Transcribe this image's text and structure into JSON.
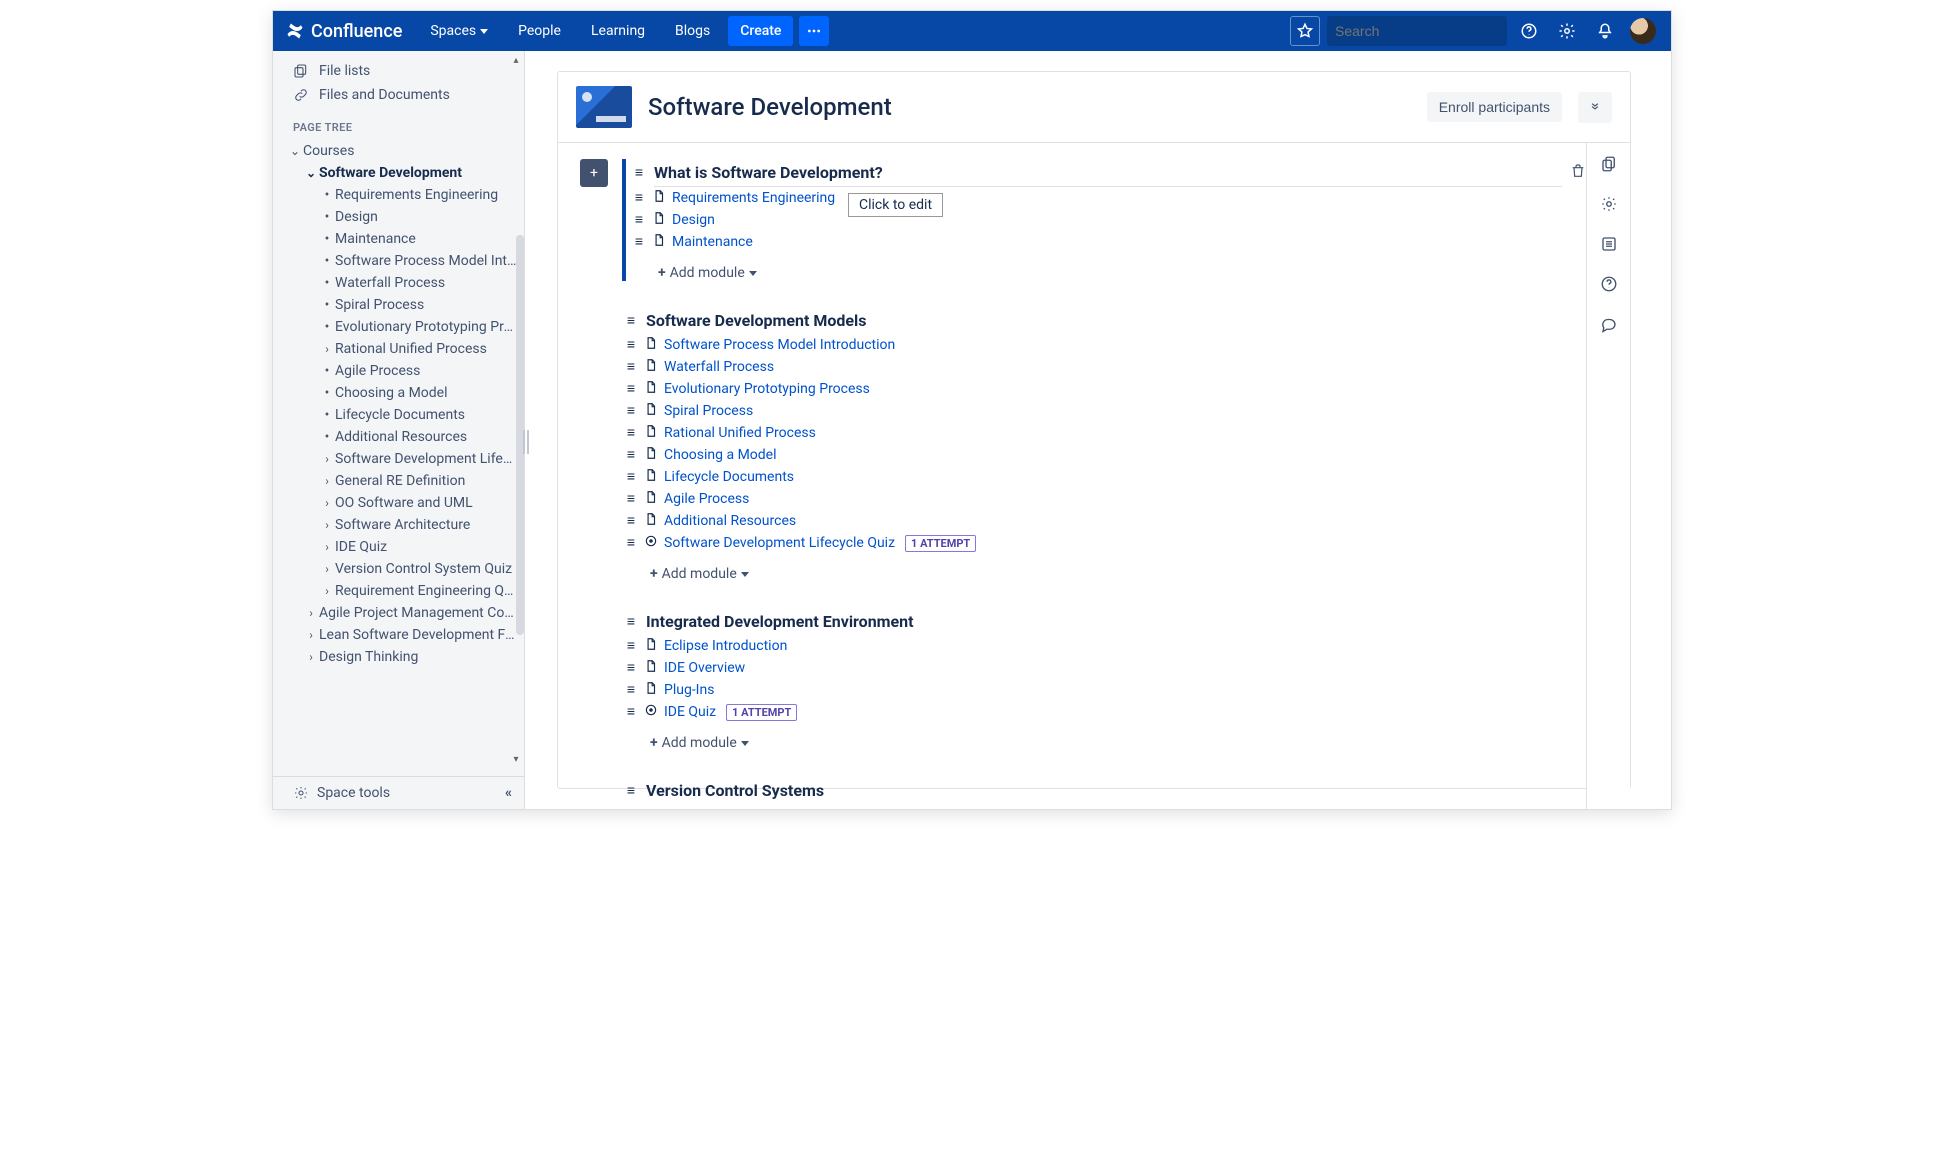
{
  "header": {
    "product": "Confluence",
    "nav": {
      "spaces": "Spaces",
      "people": "People",
      "learning": "Learning",
      "blogs": "Blogs",
      "create": "Create"
    },
    "search_placeholder": "Search"
  },
  "sidebar": {
    "links": {
      "file_lists": "File lists",
      "files_docs": "Files and Documents"
    },
    "page_tree_heading": "PAGE TREE",
    "tree": {
      "root": "Courses",
      "current": "Software Development",
      "children": [
        {
          "label": "Requirements Engineering",
          "kind": "dot"
        },
        {
          "label": "Design",
          "kind": "dot"
        },
        {
          "label": "Maintenance",
          "kind": "dot"
        },
        {
          "label": "Software Process Model Introduction",
          "kind": "dot"
        },
        {
          "label": "Waterfall Process",
          "kind": "dot"
        },
        {
          "label": "Spiral Process",
          "kind": "dot"
        },
        {
          "label": "Evolutionary Prototyping Process",
          "kind": "dot"
        },
        {
          "label": "Rational Unified Process",
          "kind": "exp"
        },
        {
          "label": "Agile Process",
          "kind": "dot"
        },
        {
          "label": "Choosing a Model",
          "kind": "dot"
        },
        {
          "label": "Lifecycle Documents",
          "kind": "dot"
        },
        {
          "label": "Additional Resources",
          "kind": "dot"
        },
        {
          "label": "Software Development Lifecycle Quiz",
          "kind": "exp"
        },
        {
          "label": "General RE Definition",
          "kind": "exp"
        },
        {
          "label": "OO Software and UML",
          "kind": "exp"
        },
        {
          "label": "Software Architecture",
          "kind": "exp"
        },
        {
          "label": "IDE Quiz",
          "kind": "exp"
        },
        {
          "label": "Version Control System Quiz",
          "kind": "exp"
        },
        {
          "label": "Requirement Engineering Quiz",
          "kind": "exp"
        }
      ],
      "siblings": [
        {
          "label": "Agile Project Management Course",
          "kind": "exp"
        },
        {
          "label": "Lean Software Development Fundamentals",
          "kind": "exp"
        },
        {
          "label": "Design Thinking",
          "kind": "exp"
        }
      ]
    },
    "space_tools": "Space tools"
  },
  "page": {
    "title": "Software Development",
    "enroll_btn": "Enroll participants",
    "tooltip": "Click to edit",
    "add_module": "Add module",
    "attempt_badge": "1 ATTEMPT",
    "sections": [
      {
        "title": "What is Software Development?",
        "modules": [
          {
            "label": "Requirements Engineering",
            "type": "doc"
          },
          {
            "label": "Design",
            "type": "doc"
          },
          {
            "label": "Maintenance",
            "type": "doc"
          }
        ]
      },
      {
        "title": "Software Development Models",
        "modules": [
          {
            "label": "Software Process Model Introduction",
            "type": "doc"
          },
          {
            "label": "Waterfall Process",
            "type": "doc"
          },
          {
            "label": "Evolutionary Prototyping Process",
            "type": "doc"
          },
          {
            "label": "Spiral Process",
            "type": "doc"
          },
          {
            "label": "Rational Unified Process",
            "type": "doc"
          },
          {
            "label": "Choosing a Model",
            "type": "doc"
          },
          {
            "label": "Lifecycle Documents",
            "type": "doc"
          },
          {
            "label": "Agile Process",
            "type": "doc"
          },
          {
            "label": "Additional Resources",
            "type": "doc"
          },
          {
            "label": "Software Development Lifecycle Quiz",
            "type": "quiz"
          }
        ]
      },
      {
        "title": "Integrated Development Environment",
        "modules": [
          {
            "label": "Eclipse Introduction",
            "type": "doc"
          },
          {
            "label": "IDE Overview",
            "type": "doc"
          },
          {
            "label": "Plug-Ins",
            "type": "doc"
          },
          {
            "label": "IDE Quiz",
            "type": "quiz"
          }
        ]
      },
      {
        "title": "Version Control Systems",
        "modules": []
      }
    ]
  }
}
